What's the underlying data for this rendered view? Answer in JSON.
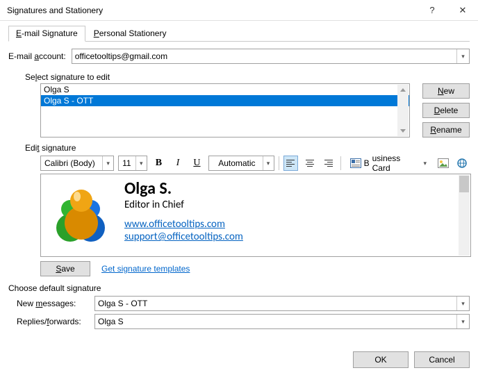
{
  "window": {
    "title": "Signatures and Stationery"
  },
  "tabs": {
    "email": "E-mail Signature",
    "stationery": "Personal Stationery"
  },
  "account": {
    "label": "E-mail account:",
    "value": "officetooltips@gmail.com"
  },
  "select_label": "Select signature to edit",
  "signatures": {
    "items": [
      "Olga S",
      "Olga S - OTT"
    ],
    "selected_index": 1
  },
  "buttons": {
    "new": "New",
    "delete": "Delete",
    "rename": "Rename",
    "save": "Save",
    "ok": "OK",
    "cancel": "Cancel"
  },
  "edit_label": "Edit signature",
  "toolbar": {
    "font": "Calibri (Body)",
    "size": "11",
    "color": "Automatic",
    "business_card": "Business Card"
  },
  "signature_preview": {
    "name": "Olga S.",
    "role": "Editor in Chief",
    "website": "www.officetooltips.com",
    "email": "support@officetooltips.com"
  },
  "templates_link": "Get signature templates",
  "defaults": {
    "heading": "Choose default signature",
    "new_label": "New messages:",
    "new_value": "Olga S - OTT",
    "reply_label": "Replies/forwards:",
    "reply_value": "Olga S"
  }
}
